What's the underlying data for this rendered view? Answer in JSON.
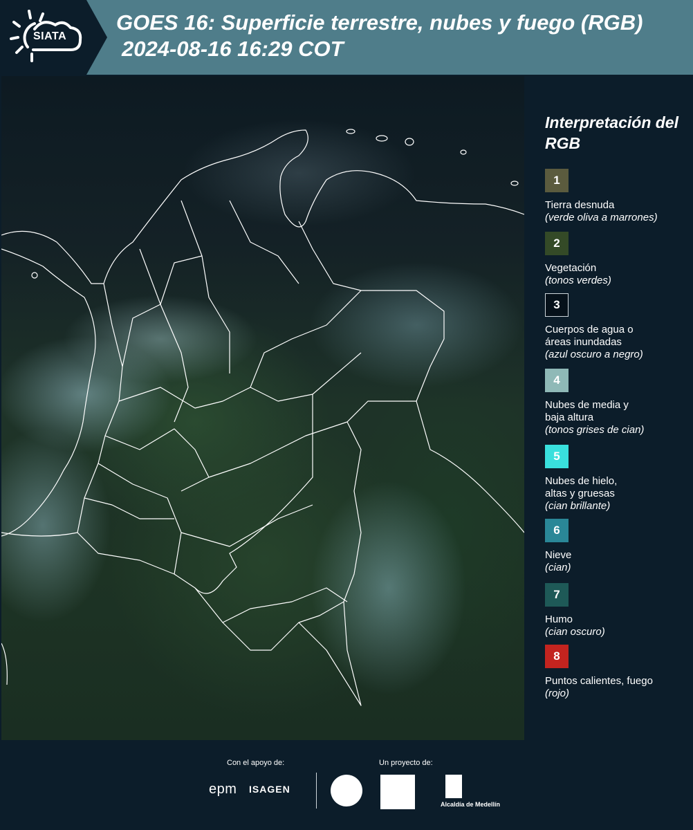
{
  "header": {
    "logo_text": "SIATA",
    "title": "GOES 16: Superficie terrestre, nubes y fuego (RGB)",
    "subtitle": "2024-08-16 16:29 COT"
  },
  "legend": {
    "title": "Interpretación del RGB",
    "items": [
      {
        "number": "1",
        "color": "#5b5b3e",
        "label": "Tierra desnuda",
        "note": "(verde oliva a marrones)"
      },
      {
        "number": "2",
        "color": "#344a27",
        "label": "Vegetación",
        "note": "(tonos verdes)"
      },
      {
        "number": "3",
        "color": "#06111a",
        "label": "Cuerpos de agua o áreas inundadas",
        "note": "(azul oscuro a negro)"
      },
      {
        "number": "4",
        "color": "#8fb9b7",
        "label": "Nubes de media y baja altura",
        "note": "(tonos grises de cian)"
      },
      {
        "number": "5",
        "color": "#39e0dd",
        "label": "Nubes de hielo, altas y gruesas",
        "note": "(cian brillante)"
      },
      {
        "number": "6",
        "color": "#2a8797",
        "label": "Nieve",
        "note": "(cian)"
      },
      {
        "number": "7",
        "color": "#1e5957",
        "label": "Humo",
        "note": "(cian oscuro)"
      },
      {
        "number": "8",
        "color": "#c3241f",
        "label": "Puntos calientes, fuego",
        "note": "(rojo)"
      }
    ]
  },
  "footer": {
    "support_label": "Con el apoyo de:",
    "project_label": "Un proyecto de:",
    "sponsor_1": "epm",
    "sponsor_2": "ISAGEN",
    "partner_alcaldia": "Alcaldía de Medellín"
  }
}
